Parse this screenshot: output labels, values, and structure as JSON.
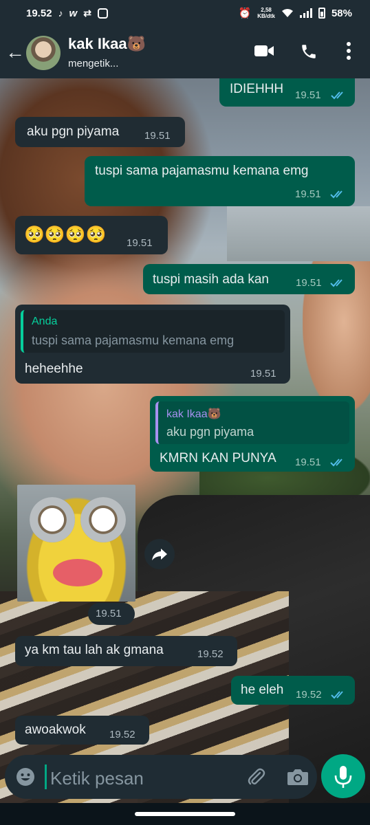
{
  "status_bar": {
    "time": "19.52",
    "speed_value": "2,58",
    "speed_unit": "KB/dtk",
    "battery": "58%"
  },
  "header": {
    "contact_name": "kak Ikaa🐻",
    "status": "mengetik..."
  },
  "messages": [
    {
      "dir": "out",
      "text": "IDIEHHH",
      "time": "19.51",
      "read": true
    },
    {
      "dir": "in",
      "text": "aku pgn piyama",
      "time": "19.51"
    },
    {
      "dir": "out",
      "text": "tuspi sama pajamasmu kemana emg",
      "time": "19.51",
      "read": true
    },
    {
      "dir": "in",
      "text": "🥺🥺🥺🥺",
      "time": "19.51"
    },
    {
      "dir": "out",
      "text": "tuspi masih ada kan",
      "time": "19.51",
      "read": true
    },
    {
      "dir": "in",
      "quote_name": "Anda",
      "quote_text": "tuspi sama pajamasmu kemana emg",
      "text": "heheehhe",
      "time": "19.51"
    },
    {
      "dir": "out",
      "quote_name": "kak Ikaa🐻",
      "quote_text": "aku pgn piyama",
      "text": "KMRN KAN PUNYA",
      "time": "19.51",
      "read": true
    },
    {
      "dir": "in",
      "sticker": true,
      "time": "19.51"
    },
    {
      "dir": "in",
      "text": "ya km tau lah ak gmana",
      "time": "19.52"
    },
    {
      "dir": "out",
      "text": "he eleh",
      "time": "19.52",
      "read": true
    },
    {
      "dir": "in",
      "text": "awoakwok",
      "time": "19.52"
    }
  ],
  "composer": {
    "placeholder": "Ketik pesan"
  },
  "colors": {
    "outgoing_bubble": "#005c4b",
    "incoming_bubble": "#202c33",
    "accent": "#00a884",
    "read_ticks": "#53bdeb"
  },
  "icons": [
    "back-arrow-icon",
    "video-call-icon",
    "voice-call-icon",
    "more-options-icon",
    "emoji-icon",
    "attach-icon",
    "camera-icon",
    "mic-icon",
    "forward-icon",
    "double-check-icon"
  ]
}
